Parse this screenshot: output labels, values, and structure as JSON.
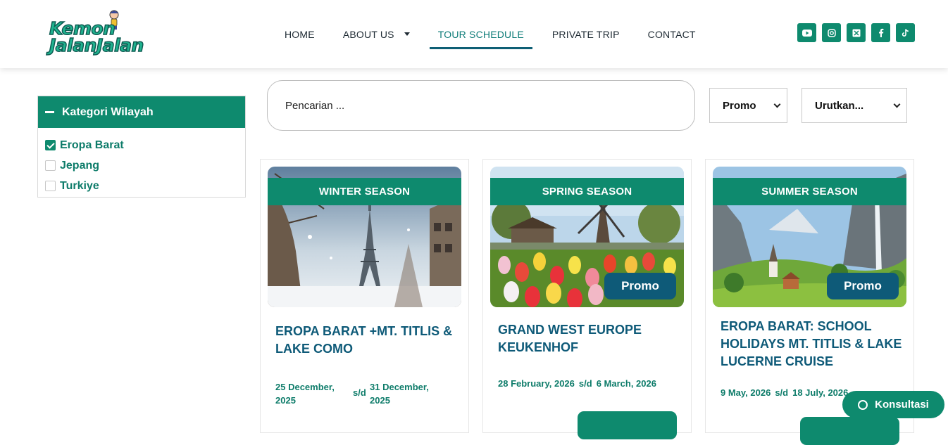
{
  "logo": {
    "line1": "Kemon",
    "line2": "JalanJalan"
  },
  "nav": {
    "items": [
      {
        "label": "HOME"
      },
      {
        "label": "ABOUT US"
      },
      {
        "label": "TOUR SCHEDULE"
      },
      {
        "label": "PRIVATE TRIP"
      },
      {
        "label": "CONTACT"
      }
    ],
    "active": "TOUR SCHEDULE"
  },
  "socials": [
    "youtube-icon",
    "instagram-icon",
    "x-icon",
    "facebook-icon",
    "tiktok-icon"
  ],
  "sidebar": {
    "title": "Kategori Wilayah",
    "items": [
      {
        "label": "Eropa Barat",
        "checked": true
      },
      {
        "label": "Jepang",
        "checked": false
      },
      {
        "label": "Turkiye",
        "checked": false
      }
    ]
  },
  "search": {
    "placeholder": "Pencarian ..."
  },
  "filters": {
    "promo": "Promo",
    "sort": "Urutkan..."
  },
  "cards": [
    {
      "season": "WINTER SEASON",
      "title": "EROPA BARAT +MT. TITLIS & LAKE COMO",
      "date_from": "25 December, 2025",
      "sep": "s/d",
      "date_to": "31 December, 2025",
      "promo": ""
    },
    {
      "season": "SPRING SEASON",
      "title": "GRAND WEST EUROPE KEUKENHOF",
      "date_from": "28 February, 2026",
      "sep": "s/d",
      "date_to": "6 March, 2026",
      "promo": "Promo"
    },
    {
      "season": "SUMMER SEASON",
      "title": "EROPA BARAT: SCHOOL HOLIDAYS MT. TITLIS & LAKE LUCERNE CRUISE",
      "date_from": "9 May, 2026",
      "sep": "s/d",
      "date_to": "18 July, 2026",
      "promo": "Promo"
    }
  ],
  "konsultasi": {
    "label": "Konsultasi"
  },
  "colors": {
    "primary": "#0e8a6e",
    "title": "#0e5a78",
    "promo": "#0e5a78"
  }
}
